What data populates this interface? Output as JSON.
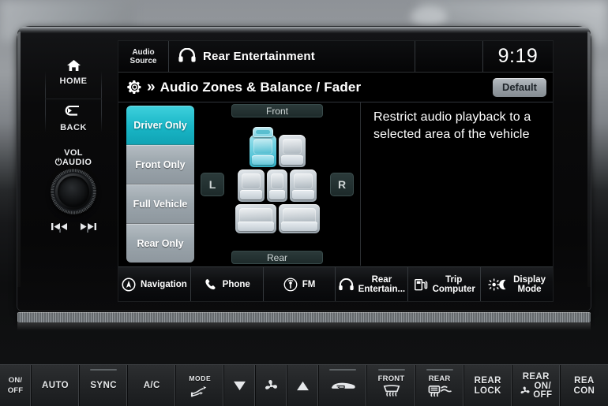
{
  "hardkeys": {
    "home": {
      "label": "HOME",
      "icon": "home-icon"
    },
    "back": {
      "label": "BACK",
      "icon": "back-arrow-icon"
    },
    "volume": {
      "line1": "VOL",
      "line2": "AUDIO",
      "power_icon": "power-icon",
      "knob": "volume-knob"
    },
    "seek_prev": {
      "icon": "seek-previous-icon"
    },
    "seek_next": {
      "icon": "seek-next-icon"
    }
  },
  "statusbar": {
    "source_label_line1": "Audio",
    "source_label_line2": "Source",
    "now_playing_icon": "headphones-icon",
    "now_playing": "Rear Entertainment",
    "clock": "9:19"
  },
  "titlebar": {
    "gear_icon": "gear-icon",
    "chevron": "»",
    "title": "Audio Zones & Balance / Fader",
    "default_button": "Default"
  },
  "zones": {
    "items": [
      {
        "label": "Driver Only",
        "selected": true
      },
      {
        "label": "Front Only",
        "selected": false
      },
      {
        "label": "Full Vehicle",
        "selected": false
      },
      {
        "label": "Rear Only",
        "selected": false
      }
    ],
    "active_color": "#19b6c6",
    "inactive_color": "#9aa4ab"
  },
  "seatmap": {
    "front_label": "Front",
    "rear_label": "Rear",
    "left_button": "L",
    "right_button": "R",
    "highlight_color": "#6fd0e0",
    "rows": [
      {
        "name": "row-1",
        "seats": [
          {
            "position": "driver",
            "active": true,
            "steering_wheel": true
          },
          {
            "position": "front-passenger",
            "active": false,
            "steering_wheel": false
          }
        ]
      },
      {
        "name": "row-2",
        "seats": [
          {
            "position": "second-row-left",
            "active": false,
            "steering_wheel": false
          },
          {
            "position": "second-row-middle",
            "active": false,
            "steering_wheel": false
          },
          {
            "position": "second-row-right",
            "active": false,
            "steering_wheel": false
          }
        ]
      },
      {
        "name": "row-3",
        "seats": [
          {
            "position": "third-row-left",
            "active": false,
            "steering_wheel": false
          },
          {
            "position": "third-row-right",
            "active": false,
            "steering_wheel": false
          }
        ]
      }
    ]
  },
  "description": {
    "text": "Restrict audio playback to a selected area of the vehicle"
  },
  "sourcebar": {
    "items": [
      {
        "label": "Navigation",
        "icon": "navigation-compass-icon",
        "lines": [
          "Navigation"
        ]
      },
      {
        "label": "Phone",
        "icon": "phone-handset-icon",
        "lines": [
          "Phone"
        ]
      },
      {
        "label": "FM",
        "icon": "radio-broadcast-icon",
        "lines": [
          "FM"
        ]
      },
      {
        "label": "Rear Entertain...",
        "icon": "headphones-icon",
        "lines": [
          "Rear",
          "Entertain..."
        ]
      },
      {
        "label": "Trip Computer",
        "icon": "fuel-pump-icon",
        "lines": [
          "Trip",
          "Computer"
        ]
      },
      {
        "label": "Display Mode",
        "icon": "brightness-day-night-icon",
        "lines": [
          "Display",
          "Mode"
        ]
      }
    ]
  },
  "climate": {
    "buttons": [
      {
        "id": "on-off",
        "lines": [
          "ON/",
          "OFF"
        ],
        "icon": null,
        "led": false,
        "size": "tiny"
      },
      {
        "id": "auto",
        "lines": [
          "AUTO"
        ],
        "icon": null,
        "led": false,
        "size": "normal"
      },
      {
        "id": "sync",
        "lines": [
          "SYNC"
        ],
        "icon": null,
        "led": true,
        "size": "normal"
      },
      {
        "id": "ac",
        "lines": [
          "A/C"
        ],
        "icon": null,
        "led": false,
        "size": "normal"
      },
      {
        "id": "mode",
        "lines": [
          "MODE"
        ],
        "icon": "airflow-mode-icon",
        "led": false,
        "size": "normal"
      },
      {
        "id": "fan-down",
        "lines": [],
        "icon": "triangle-down-icon",
        "led": false,
        "size": "tiny"
      },
      {
        "id": "fan",
        "lines": [],
        "icon": "fan-icon",
        "led": false,
        "size": "tiny"
      },
      {
        "id": "fan-up",
        "lines": [],
        "icon": "triangle-up-icon",
        "led": false,
        "size": "tiny"
      },
      {
        "id": "recirculate",
        "lines": [],
        "icon": "recirculation-car-icon",
        "led": true,
        "size": "normal"
      },
      {
        "id": "front-defrost",
        "lines": [
          "FRONT"
        ],
        "icon": "front-defrost-icon",
        "led": true,
        "size": "normal"
      },
      {
        "id": "rear-defrost",
        "lines": [
          "REAR"
        ],
        "icon": "rear-defrost-icon",
        "led": true,
        "size": "normal"
      },
      {
        "id": "rear-lock",
        "lines": [
          "REAR",
          "LOCK"
        ],
        "icon": null,
        "led": false,
        "size": "normal"
      },
      {
        "id": "rear-on-off",
        "lines": [
          "REAR",
          "ON/",
          "OFF"
        ],
        "icon": "fan-icon",
        "led": false,
        "size": "normal"
      },
      {
        "id": "rear-control",
        "lines": [
          "REA",
          "CON"
        ],
        "icon": null,
        "led": false,
        "size": "normal"
      }
    ]
  }
}
